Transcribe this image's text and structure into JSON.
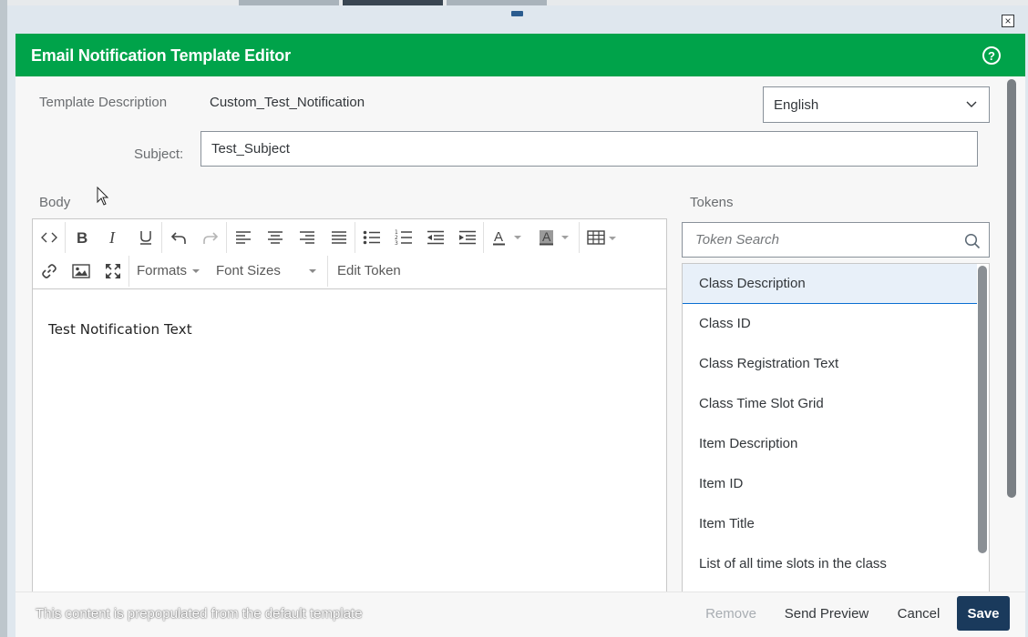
{
  "header": {
    "title": "Email Notification Template Editor",
    "help_icon": "help-circle-icon"
  },
  "template": {
    "description_label": "Template Description",
    "description_value": "Custom_Test_Notification",
    "language": "English",
    "subject_label": "Subject:",
    "subject_value": "Test_Subject"
  },
  "body": {
    "label": "Body",
    "toolbar": {
      "formats_label": "Formats",
      "font_sizes_label": "Font Sizes",
      "edit_token_label": "Edit Token"
    },
    "content": "Test Notification Text"
  },
  "tokens": {
    "label": "Tokens",
    "search_placeholder": "Token Search",
    "items": [
      "Class Description",
      "Class ID",
      "Class Registration Text",
      "Class Time Slot Grid",
      "Item Description",
      "Item ID",
      "Item Title",
      "List of all time slots in the class"
    ],
    "selected_index": 0
  },
  "footer": {
    "note": "This content is prepopulated from the default template",
    "remove_label": "Remove",
    "send_preview_label": "Send Preview",
    "cancel_label": "Cancel",
    "save_label": "Save"
  },
  "colors": {
    "header_bg": "#00a34a",
    "save_bg": "#1a3a5c",
    "selected_border": "#0a6ed1"
  }
}
